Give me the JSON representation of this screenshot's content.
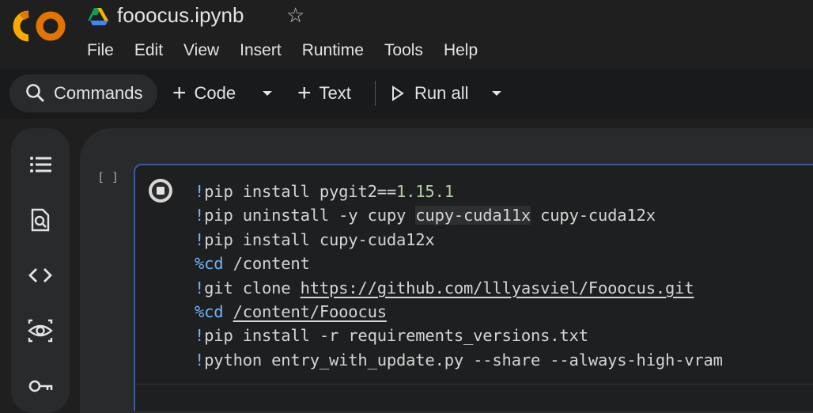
{
  "app": {
    "logo_text": "CO",
    "notebook_title": "fooocus.ipynb"
  },
  "menu": [
    "File",
    "Edit",
    "View",
    "Insert",
    "Runtime",
    "Tools",
    "Help"
  ],
  "toolbar": {
    "commands_label": "Commands",
    "code_label": "Code",
    "text_label": "Text",
    "run_all_label": "Run all"
  },
  "sidebar_icons": [
    "table-of-contents-icon",
    "find-icon",
    "code-snippets-icon",
    "variables-icon",
    "secrets-key-icon"
  ],
  "cell": {
    "execution_count": "[ ]",
    "lines": [
      [
        {
          "t": "!",
          "c": "bang"
        },
        {
          "t": "pip install pygit2=="
        },
        {
          "t": "1.15.1",
          "c": "num"
        }
      ],
      [
        {
          "t": "!",
          "c": "bang"
        },
        {
          "t": "pip uninstall -y cupy "
        },
        {
          "t": "cupy-cuda11x",
          "c": "hl"
        },
        {
          "t": " cupy-cuda12x"
        }
      ],
      [
        {
          "t": "!",
          "c": "bang"
        },
        {
          "t": "pip install cupy-cuda12x"
        }
      ],
      [
        {
          "t": "%cd",
          "c": "magic"
        },
        {
          "t": " /content"
        }
      ],
      [
        {
          "t": "!",
          "c": "bang"
        },
        {
          "t": "git clone "
        },
        {
          "t": "https://github.com/lllyasviel/Fooocus.git",
          "c": "link"
        }
      ],
      [
        {
          "t": "%cd",
          "c": "magic"
        },
        {
          "t": " "
        },
        {
          "t": "/content/Fooocus",
          "c": "link"
        }
      ],
      [
        {
          "t": "!",
          "c": "bang"
        },
        {
          "t": "pip install -r requirements_versions.txt"
        }
      ],
      [
        {
          "t": "!",
          "c": "bang"
        },
        {
          "t": "python entry_with_update.py --share --always-high-vram"
        }
      ]
    ]
  },
  "colors": {
    "accent_orange": "#f9ab00",
    "accent_orange_dark": "#e37400",
    "cell_border": "#3d5a99",
    "keyword_blue": "#6fb3f5"
  }
}
